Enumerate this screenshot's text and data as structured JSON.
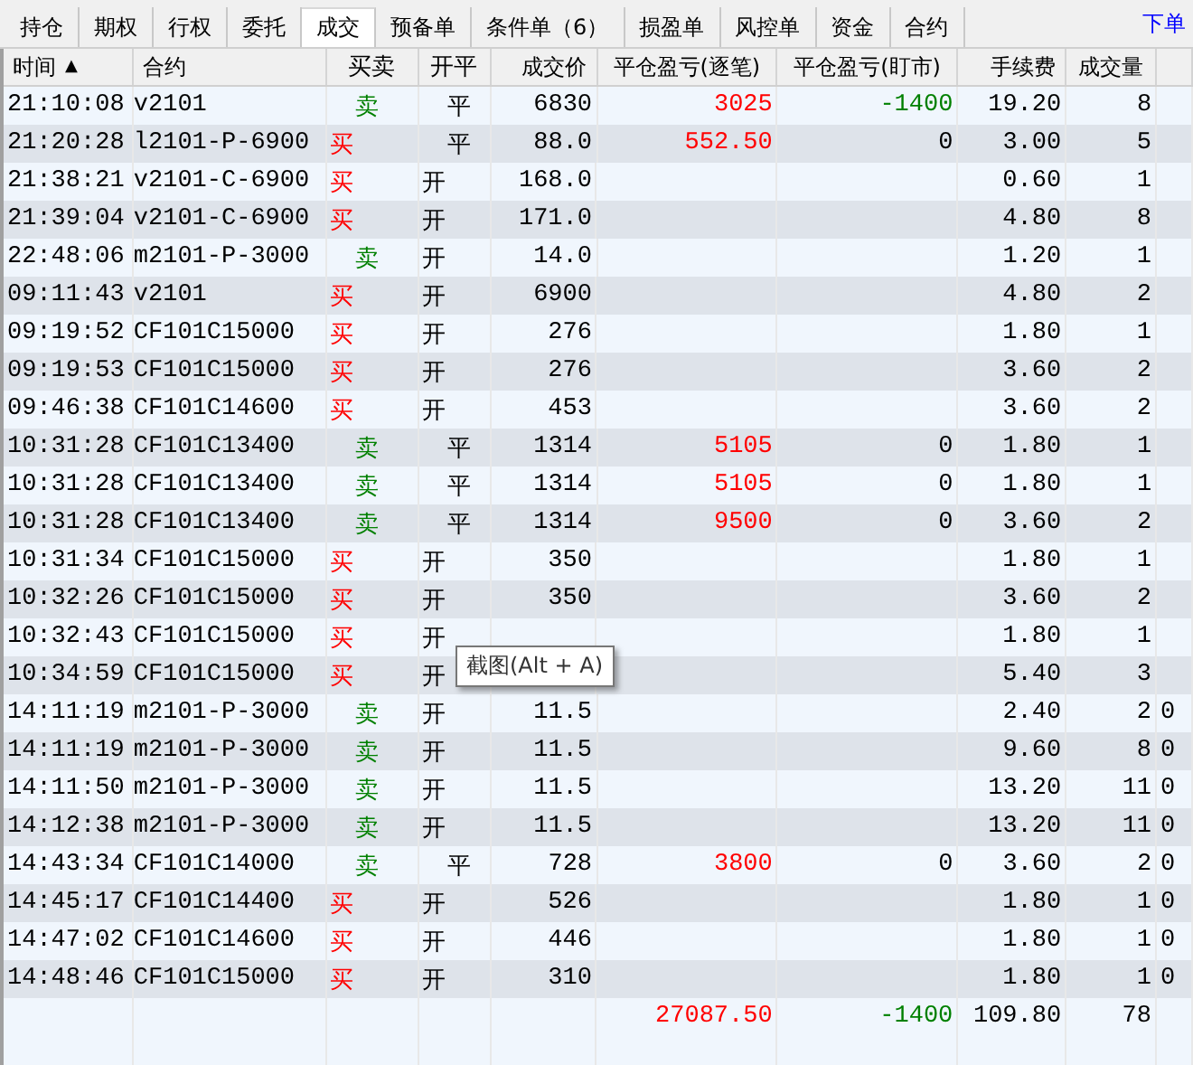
{
  "tabs": [
    {
      "label": "持仓",
      "selected": false
    },
    {
      "label": "期权",
      "selected": false
    },
    {
      "label": "行权",
      "selected": false
    },
    {
      "label": "委托",
      "selected": false
    },
    {
      "label": "成交",
      "selected": true
    },
    {
      "label": "预备单",
      "selected": false
    },
    {
      "label": "条件单（6）",
      "selected": false
    },
    {
      "label": "损盈单",
      "selected": false
    },
    {
      "label": "风控单",
      "selected": false
    },
    {
      "label": "资金",
      "selected": false
    },
    {
      "label": "合约",
      "selected": false
    }
  ],
  "order_link": "下单",
  "table": {
    "columns": [
      {
        "label": "时间",
        "sort_icon": "▲"
      },
      {
        "label": "合约"
      },
      {
        "label": "买卖"
      },
      {
        "label": "开平"
      },
      {
        "label": "成交价"
      },
      {
        "label": "平仓盈亏(逐笔)"
      },
      {
        "label": "平仓盈亏(盯市)"
      },
      {
        "label": "手续费"
      },
      {
        "label": "成交量"
      }
    ],
    "rows": [
      {
        "time": "21:10:08",
        "contract": "v2101",
        "side": {
          "text": "卖",
          "kind": "sell"
        },
        "offset": {
          "text": "平",
          "kind": "close"
        },
        "price": "6830",
        "pnl_trade": {
          "text": "3025",
          "color": "#ff0000"
        },
        "pnl_mark": {
          "text": "-1400",
          "color": "#008000"
        },
        "fee": "19.20",
        "qty": "8"
      },
      {
        "time": "21:20:28",
        "contract": "l2101-P-6900",
        "side": {
          "text": "买",
          "kind": "buy"
        },
        "offset": {
          "text": "平",
          "kind": "close"
        },
        "price": "88.0",
        "pnl_trade": {
          "text": "552.50",
          "color": "#ff0000"
        },
        "pnl_mark": {
          "text": "0",
          "color": "#000000"
        },
        "fee": "3.00",
        "qty": "5"
      },
      {
        "time": "21:38:21",
        "contract": "v2101-C-6900",
        "side": {
          "text": "买",
          "kind": "buy"
        },
        "offset": {
          "text": "开",
          "kind": "open"
        },
        "price": "168.0",
        "fee": "0.60",
        "qty": "1"
      },
      {
        "time": "21:39:04",
        "contract": "v2101-C-6900",
        "side": {
          "text": "买",
          "kind": "buy"
        },
        "offset": {
          "text": "开",
          "kind": "open"
        },
        "price": "171.0",
        "fee": "4.80",
        "qty": "8"
      },
      {
        "time": "22:48:06",
        "contract": "m2101-P-3000",
        "side": {
          "text": "卖",
          "kind": "sell"
        },
        "offset": {
          "text": "开",
          "kind": "open"
        },
        "price": "14.0",
        "fee": "1.20",
        "qty": "1"
      },
      {
        "time": "09:11:43",
        "contract": "v2101",
        "side": {
          "text": "买",
          "kind": "buy"
        },
        "offset": {
          "text": "开",
          "kind": "open"
        },
        "price": "6900",
        "fee": "4.80",
        "qty": "2"
      },
      {
        "time": "09:19:52",
        "contract": "CF101C15000",
        "side": {
          "text": "买",
          "kind": "buy"
        },
        "offset": {
          "text": "开",
          "kind": "open"
        },
        "price": "276",
        "fee": "1.80",
        "qty": "1"
      },
      {
        "time": "09:19:53",
        "contract": "CF101C15000",
        "side": {
          "text": "买",
          "kind": "buy"
        },
        "offset": {
          "text": "开",
          "kind": "open"
        },
        "price": "276",
        "fee": "3.60",
        "qty": "2"
      },
      {
        "time": "09:46:38",
        "contract": "CF101C14600",
        "side": {
          "text": "买",
          "kind": "buy"
        },
        "offset": {
          "text": "开",
          "kind": "open"
        },
        "price": "453",
        "fee": "3.60",
        "qty": "2"
      },
      {
        "time": "10:31:28",
        "contract": "CF101C13400",
        "side": {
          "text": "卖",
          "kind": "sell"
        },
        "offset": {
          "text": "平",
          "kind": "close"
        },
        "price": "1314",
        "pnl_trade": {
          "text": "5105",
          "color": "#ff0000"
        },
        "pnl_mark": {
          "text": "0",
          "color": "#000000"
        },
        "fee": "1.80",
        "qty": "1"
      },
      {
        "time": "10:31:28",
        "contract": "CF101C13400",
        "side": {
          "text": "卖",
          "kind": "sell"
        },
        "offset": {
          "text": "平",
          "kind": "close"
        },
        "price": "1314",
        "pnl_trade": {
          "text": "5105",
          "color": "#ff0000"
        },
        "pnl_mark": {
          "text": "0",
          "color": "#000000"
        },
        "fee": "1.80",
        "qty": "1"
      },
      {
        "time": "10:31:28",
        "contract": "CF101C13400",
        "side": {
          "text": "卖",
          "kind": "sell"
        },
        "offset": {
          "text": "平",
          "kind": "close"
        },
        "price": "1314",
        "pnl_trade": {
          "text": "9500",
          "color": "#ff0000"
        },
        "pnl_mark": {
          "text": "0",
          "color": "#000000"
        },
        "fee": "3.60",
        "qty": "2"
      },
      {
        "time": "10:31:34",
        "contract": "CF101C15000",
        "side": {
          "text": "买",
          "kind": "buy"
        },
        "offset": {
          "text": "开",
          "kind": "open"
        },
        "price": "350",
        "fee": "1.80",
        "qty": "1"
      },
      {
        "time": "10:32:26",
        "contract": "CF101C15000",
        "side": {
          "text": "买",
          "kind": "buy"
        },
        "offset": {
          "text": "开",
          "kind": "open"
        },
        "price": "350",
        "fee": "3.60",
        "qty": "2"
      },
      {
        "time": "10:32:43",
        "contract": "CF101C15000",
        "side": {
          "text": "买",
          "kind": "buy"
        },
        "offset": {
          "text": "开",
          "kind": "open"
        },
        "fee": "1.80",
        "qty": "1"
      },
      {
        "time": "10:34:59",
        "contract": "CF101C15000",
        "side": {
          "text": "买",
          "kind": "buy"
        },
        "offset": {
          "text": "开",
          "kind": "open"
        },
        "fee": "5.40",
        "qty": "3"
      },
      {
        "time": "14:11:19",
        "contract": "m2101-P-3000",
        "side": {
          "text": "卖",
          "kind": "sell"
        },
        "offset": {
          "text": "开",
          "kind": "open"
        },
        "price": "11.5",
        "fee": "2.40",
        "qty": "2",
        "column_10": "0"
      },
      {
        "time": "14:11:19",
        "contract": "m2101-P-3000",
        "side": {
          "text": "卖",
          "kind": "sell"
        },
        "offset": {
          "text": "开",
          "kind": "open"
        },
        "price": "11.5",
        "fee": "9.60",
        "qty": "8",
        "column_10": "0"
      },
      {
        "time": "14:11:50",
        "contract": "m2101-P-3000",
        "side": {
          "text": "卖",
          "kind": "sell"
        },
        "offset": {
          "text": "开",
          "kind": "open"
        },
        "price": "11.5",
        "fee": "13.20",
        "qty": "11",
        "column_10": "0"
      },
      {
        "time": "14:12:38",
        "contract": "m2101-P-3000",
        "side": {
          "text": "卖",
          "kind": "sell"
        },
        "offset": {
          "text": "开",
          "kind": "open"
        },
        "price": "11.5",
        "fee": "13.20",
        "qty": "11",
        "column_10": "0"
      },
      {
        "time": "14:43:34",
        "contract": "CF101C14000",
        "side": {
          "text": "卖",
          "kind": "sell"
        },
        "offset": {
          "text": "平",
          "kind": "close"
        },
        "price": "728",
        "pnl_trade": {
          "text": "3800",
          "color": "#ff0000"
        },
        "pnl_mark": {
          "text": "0",
          "color": "#000000"
        },
        "fee": "3.60",
        "qty": "2",
        "column_10": "0"
      },
      {
        "time": "14:45:17",
        "contract": "CF101C14400",
        "side": {
          "text": "买",
          "kind": "buy"
        },
        "offset": {
          "text": "开",
          "kind": "open"
        },
        "price": "526",
        "fee": "1.80",
        "qty": "1",
        "column_10": "0"
      },
      {
        "time": "14:47:02",
        "contract": "CF101C14600",
        "side": {
          "text": "买",
          "kind": "buy"
        },
        "offset": {
          "text": "开",
          "kind": "open"
        },
        "price": "446",
        "fee": "1.80",
        "qty": "1",
        "column_10": "0"
      },
      {
        "time": "14:48:46",
        "contract": "CF101C15000",
        "side": {
          "text": "买",
          "kind": "buy"
        },
        "offset": {
          "text": "开",
          "kind": "open"
        },
        "price": "310",
        "fee": "1.80",
        "qty": "1",
        "column_10": "0"
      }
    ],
    "total": {
      "pnl_trade": {
        "text": "27087.50",
        "color": "#ff0000"
      },
      "pnl_mark": {
        "text": "-1400",
        "color": "#008000"
      },
      "fee": "109.80",
      "qty": "78"
    }
  },
  "tooltip": "截图(Alt + A)"
}
